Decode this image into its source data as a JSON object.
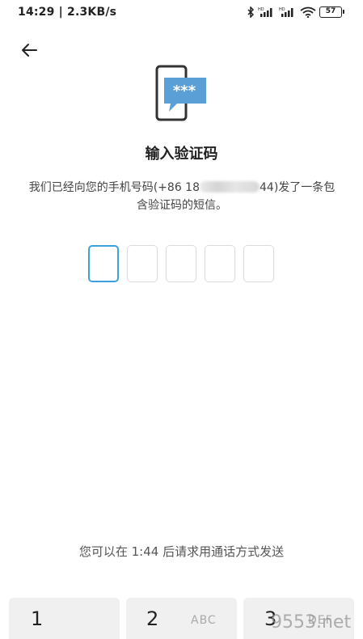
{
  "status_bar": {
    "time_speed": "14:29 | 2.3KB/s",
    "network_badge_1": "HD",
    "network_badge_2": "HD",
    "battery_level": "57"
  },
  "icons": {
    "back": "arrow-left-icon",
    "illustration": "phone-sms-icon",
    "bluetooth": "bluetooth-icon",
    "signal": "signal-icon",
    "wifi": "wifi-icon",
    "battery": "battery-icon"
  },
  "header": {
    "title": "输入验证码"
  },
  "message": {
    "prefix": "我们已经向您的手机号码(+86 18",
    "suffix": "44)发了一条包",
    "line2": "含验证码的短信。"
  },
  "code_input": {
    "length": 5,
    "active_index": 0,
    "accent_color": "#3aa3dc"
  },
  "resend": {
    "text": "您可以在 1:44 后请求用通话方式发送"
  },
  "keypad": {
    "keys": [
      {
        "digit": "1",
        "letters": ""
      },
      {
        "digit": "2",
        "letters": "ABC"
      },
      {
        "digit": "3",
        "letters": "DEF"
      }
    ]
  },
  "watermark": "9553.net"
}
